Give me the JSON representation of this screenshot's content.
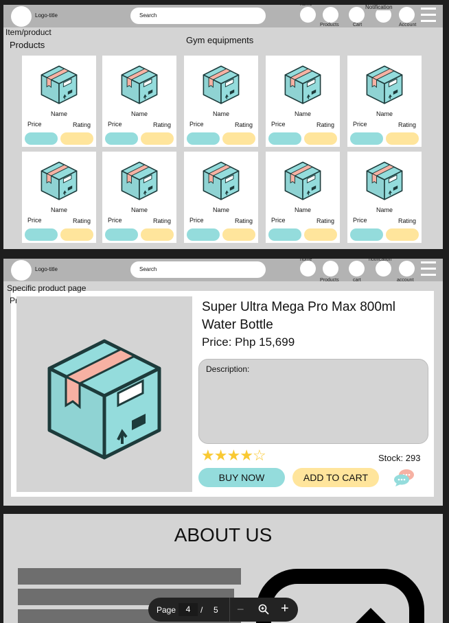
{
  "nav": {
    "logo_title": "Logo-title",
    "search_placeholder": "Search",
    "home": "home",
    "products": "Products",
    "cart": "Cart",
    "cart_lower": "cart",
    "notification": "Notification",
    "notification_lower": "notification",
    "account": "Account",
    "account_lower": "account",
    "home_top": "home"
  },
  "slide1": {
    "page_label": "Item/product",
    "section": "Products",
    "category_title": "Gym equipments",
    "products": [
      {
        "name": "Name",
        "price": "Price",
        "rating": "Rating"
      },
      {
        "name": "Name",
        "price": "Price",
        "rating": "Rating"
      },
      {
        "name": "Name",
        "price": "Price",
        "rating": "Rating"
      },
      {
        "name": "Name",
        "price": "Price",
        "rating": "Rating"
      },
      {
        "name": "Name",
        "price": "Price",
        "rating": "Rating"
      },
      {
        "name": "Name",
        "price": "Price",
        "rating": "Rating"
      },
      {
        "name": "Name",
        "price": "Price",
        "rating": "Rating"
      },
      {
        "name": "Name",
        "price": "Price",
        "rating": "Rating"
      },
      {
        "name": "Name",
        "price": "Price",
        "rating": "Rating"
      },
      {
        "name": "Name",
        "price": "Price",
        "rating": "Rating"
      }
    ]
  },
  "slide2": {
    "page_label": "Specific product page",
    "section": "Products",
    "title_line1": "Super Ultra Mega Pro Max 800ml",
    "title_line2": "Water Bottle",
    "price": "Price: Php 15,699",
    "description_label": "Description:",
    "rating": 4,
    "rating_max": 5,
    "stock": "Stock: 293",
    "buy_now": "BUY NOW",
    "add_to_cart": "ADD TO CART"
  },
  "slide3": {
    "title": "ABOUT US"
  },
  "pager": {
    "label": "Page",
    "current": "4",
    "sep": "/",
    "total": "5",
    "zoom_out": "−",
    "zoom_in": "+"
  },
  "colors": {
    "teal": "#94dcdc",
    "yellow": "#ffe59c",
    "pink": "#f6b1a3",
    "star": "#f9c932"
  }
}
